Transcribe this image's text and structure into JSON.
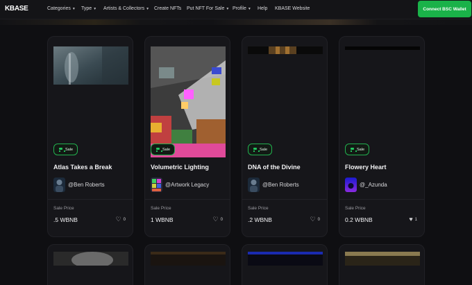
{
  "nav": {
    "logo": "KBASE",
    "items": [
      {
        "label": "Categories",
        "has_caret": true
      },
      {
        "label": "Type",
        "has_caret": true
      },
      {
        "label": "Artists & Collectors",
        "has_caret": true
      },
      {
        "label": "Create NFTs",
        "has_caret": false
      },
      {
        "label": "Put NFT For Sale",
        "has_caret": true
      },
      {
        "label": "Profile",
        "has_caret": true
      },
      {
        "label": "Help",
        "has_caret": false
      },
      {
        "label": "KBASE Website",
        "has_caret": false
      }
    ],
    "connect_button": "Connect BSC Wallet"
  },
  "colors": {
    "accent": "#1ab249",
    "background": "#0f0f12",
    "card": "#16161a"
  },
  "cards": [
    {
      "badge": "Sale",
      "title": "Atlas Takes a Break",
      "artist": "@Ben Roberts",
      "price_label": "Sale Price",
      "price": ".5 WBNB",
      "likes": "0",
      "liked": false
    },
    {
      "badge": "Sale",
      "title": "Volumetric Lighting",
      "artist": "@Artwork Legacy",
      "price_label": "Sale Price",
      "price": "1 WBNB",
      "likes": "0",
      "liked": false
    },
    {
      "badge": "Sale",
      "title": "DNA of the Divine",
      "artist": "@Ben Roberts",
      "price_label": "Sale Price",
      "price": ".2 WBNB",
      "likes": "0",
      "liked": false
    },
    {
      "badge": "Sale",
      "title": "Flowery Heart",
      "artist": "@_Azunda",
      "price_label": "Sale Price",
      "price": "0.2 WBNB",
      "likes": "1",
      "liked": true
    }
  ]
}
